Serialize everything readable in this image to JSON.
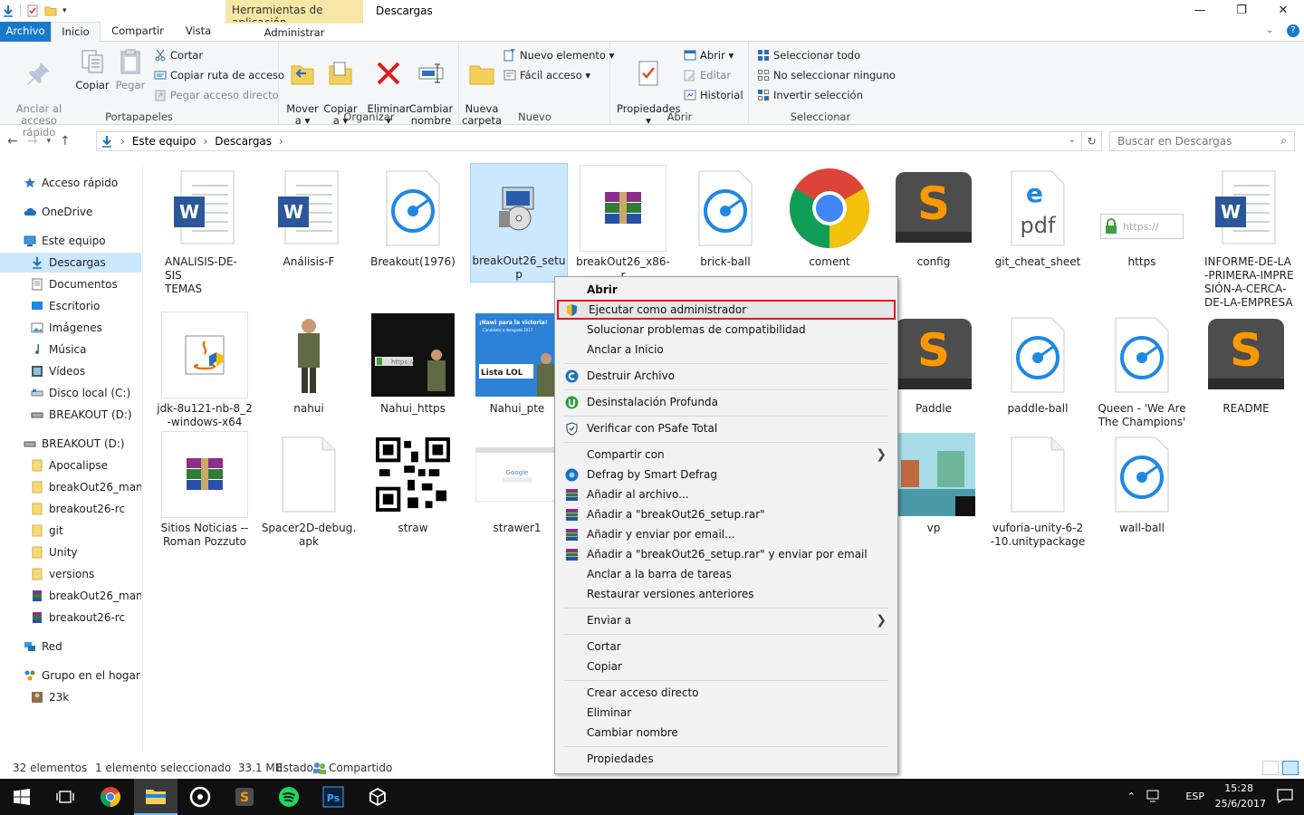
{
  "window": {
    "title": "Descargas",
    "context_tab_header": "Herramientas de aplicación",
    "minimize": "—",
    "maximize": "❐",
    "close": "✕"
  },
  "tabs": {
    "archivo": "Archivo",
    "inicio": "Inicio",
    "compartir": "Compartir",
    "vista": "Vista",
    "administrar": "Administrar"
  },
  "ribbon": {
    "portapapeles": {
      "label": "Portapapeles",
      "anclar": "Anclar al\nacceso rápido",
      "copiar": "Copiar",
      "pegar": "Pegar",
      "cortar": "Cortar",
      "copiar_ruta": "Copiar ruta de acceso",
      "pegar_acceso": "Pegar acceso directo"
    },
    "organizar": {
      "label": "Organizar",
      "mover": "Mover\na ▾",
      "copiar_a": "Copiar\na ▾",
      "eliminar": "Eliminar\n▾",
      "cambiar_nombre": "Cambiar\nnombre"
    },
    "nuevo": {
      "label": "Nuevo",
      "nueva_carpeta": "Nueva\ncarpeta",
      "nuevo_elemento": "Nuevo elemento ▾",
      "facil_acceso": "Fácil acceso ▾"
    },
    "abrir": {
      "label": "Abrir",
      "propiedades": "Propiedades\n▾",
      "abrir": "Abrir ▾",
      "editar": "Editar",
      "historial": "Historial"
    },
    "seleccionar": {
      "label": "Seleccionar",
      "todo": "Seleccionar todo",
      "ninguno": "No seleccionar ninguno",
      "invertir": "Invertir selección"
    }
  },
  "address": {
    "crumb1": "Este equipo",
    "crumb2": "Descargas",
    "search_placeholder": "Buscar en Descargas"
  },
  "nav": [
    "Acceso rápido",
    "OneDrive",
    "Este equipo",
    "Descargas",
    "Documentos",
    "Escritorio",
    "Imágenes",
    "Música",
    "Vídeos",
    "Disco local (C:)",
    "BREAKOUT (D:)",
    "BREAKOUT (D:)",
    "Apocalipse",
    "breakOut26_manua",
    "breakout26-rc",
    "git",
    "Unity",
    "versions",
    "breakOut26_manua",
    "breakout26-rc",
    "Red",
    "Grupo en el hogar",
    "23k"
  ],
  "files": [
    "ANALISIS-DE-SIS\nTEMAS",
    "Análisis-F",
    "Breakout(1976)",
    "breakOut26_setu\np",
    "breakOut26_x86-r",
    "brick-ball",
    "coment",
    "config",
    "git_cheat_sheet",
    "https",
    "INFORME-DE-LA\n-PRIMERA-IMPRE\nSIÓN-A-CERCA-\nDE-LA-EMPRESA",
    "jdk-8u121-nb-8_2\n-windows-x64",
    "nahui",
    "Nahui_https",
    "Nahui_pte",
    "Paddle",
    "paddle-ball",
    "Queen - 'We Are\nThe Champions'",
    "README",
    "Sitios Noticias --\nRoman Pozzuto",
    "Spacer2D-debug.\napk",
    "straw",
    "strawer1",
    "vp",
    "vuforia-unity-6-2\n-10.unitypackage",
    "wall-ball"
  ],
  "thumb_text": {
    "https_url": "https://",
    "nahui_https_url": "https://",
    "pte_line1": "¡Nawi para la victoria!",
    "pte_line2": "Candidato a delegado 2017",
    "pte_line3": "Lista LOL",
    "pdf": "pdf",
    "google": "Google"
  },
  "context_menu": {
    "abrir": "Abrir",
    "ejecutar": "Ejecutar como administrador",
    "solucionar": "Solucionar problemas de compatibilidad",
    "anclar_inicio": "Anclar a Inicio",
    "destruir": "Destruir Archivo",
    "desinstalacion": "Desinstalación Profunda",
    "verificar": "Verificar con PSafe Total",
    "compartir": "Compartir con",
    "defrag": "Defrag by Smart Defrag",
    "anadir": "Añadir al archivo...",
    "anadir_rar": "Añadir a \"breakOut26_setup.rar\"",
    "anadir_email": "Añadir y enviar por email...",
    "anadir_rar_email": "Añadir a \"breakOut26_setup.rar\" y enviar por email",
    "anclar_barra": "Anclar a la barra de tareas",
    "restaurar": "Restaurar versiones anteriores",
    "enviar": "Enviar a",
    "cortar": "Cortar",
    "copiar": "Copiar",
    "crear_acceso": "Crear acceso directo",
    "eliminar": "Eliminar",
    "cambiar_nombre": "Cambiar nombre",
    "propiedades": "Propiedades"
  },
  "status": {
    "count": "32 elementos",
    "selected": "1 elemento seleccionado  33.1 MB",
    "estado_label": "Estado:",
    "estado_value": "Compartido"
  },
  "tray": {
    "lang": "ESP",
    "time": "15:28",
    "date": "25/6/2017"
  }
}
